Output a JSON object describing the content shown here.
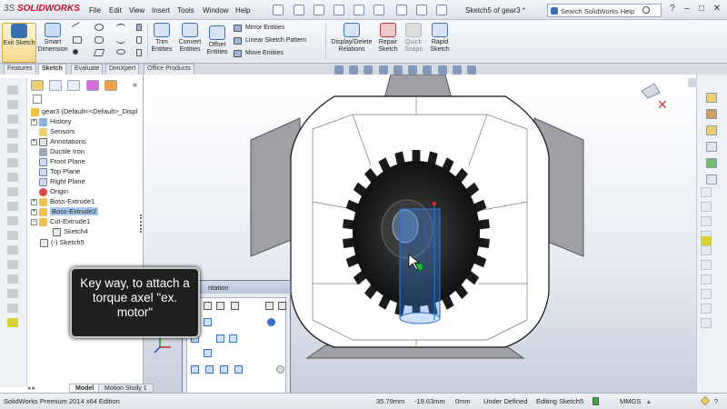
{
  "app": {
    "logo_brand": "SOLIDWORKS",
    "logo_prefix": "3S",
    "document_title": "Sketch5 of gear3 *"
  },
  "menu": [
    "File",
    "Edit",
    "View",
    "Insert",
    "Tools",
    "Window",
    "Help"
  ],
  "help_search": {
    "placeholder": "Search SolidWorks Help"
  },
  "ribbon": {
    "exit_sketch": "Exit Sketch",
    "smart_dimension": "Smart Dimension",
    "trim_entities": "Trim Entities",
    "convert_entities": "Convert Entities",
    "offset_entities": "Offset Entities",
    "mirror_entities": "Mirror Entities",
    "linear_sketch_pattern": "Linear Sketch Pattern",
    "move_entities": "Move Entities",
    "display_delete_relations": "Display/Delete Relations",
    "repair_sketch": "Repair Sketch",
    "quick_snaps": "Quick Snaps",
    "rapid_sketch": "Rapid Sketch"
  },
  "command_tabs": [
    "Features",
    "Sketch",
    "Evaluate",
    "DimXpert",
    "Office Products"
  ],
  "tree": {
    "root": "gear3  (Default<<Default>_Displ",
    "items": [
      "History",
      "Sensors",
      "Annotations",
      "Ductile Iron",
      "Front Plane",
      "Top Plane",
      "Right Plane",
      "Origin",
      "Boss-Extrude1",
      "Boss-Extrude2",
      "Cut-Extrude1",
      "Sketch4",
      "(-) Sketch5"
    ]
  },
  "callout": {
    "text": "Key way, to attach a torque axel \"ex. motor\""
  },
  "orientation_dialog": {
    "title": "ntation"
  },
  "bottom_tabs": [
    "Model",
    "Motion Study 1"
  ],
  "status": {
    "edition": "SolidWorks Premium 2014 x64 Edition",
    "x": "35.79mm",
    "y": "-19.63mm",
    "z": "0mm",
    "state": "Under Defined",
    "editing": "Editing Sketch5",
    "units": "MMGS",
    "help": "?"
  },
  "colors": {
    "accent": "#2e6fd0",
    "logo": "#c8102e",
    "gear": "#1a1a1a",
    "keyway_blue": "#3b86e8"
  }
}
